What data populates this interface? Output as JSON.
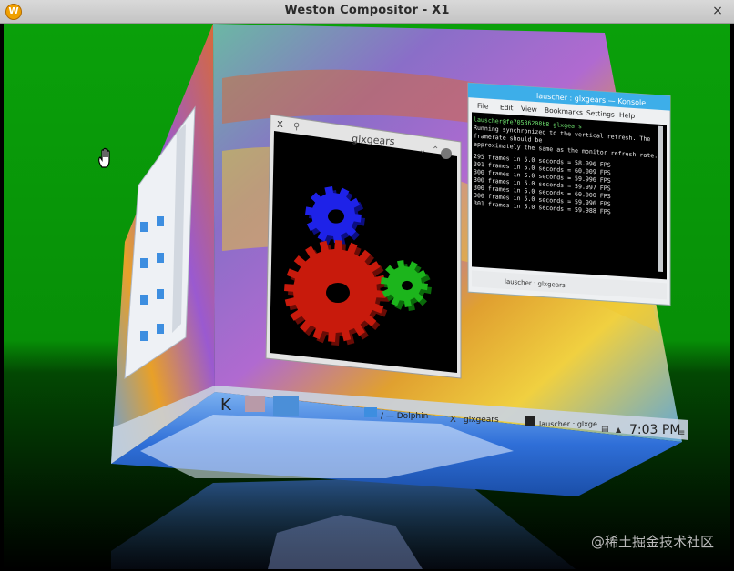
{
  "window": {
    "title": "Weston Compositor - X1",
    "close_glyph": "×",
    "app_icon_letter": "W"
  },
  "glxgears": {
    "title": "glxgears",
    "x_glyph": "X",
    "colors": {
      "blue": "#1e22e8",
      "red": "#c81a0c",
      "green": "#1cb51c"
    }
  },
  "konsole": {
    "title": "lauscher : glxgears — Konsole",
    "menu": [
      "File",
      "Edit",
      "View",
      "Bookmarks",
      "Settings",
      "Help"
    ],
    "lines": [
      "lauscher@fe70536208b8 glxgears",
      "Running synchronized to the vertical refresh.  The",
      "framerate should be",
      "approximately the same as the monitor refresh rate.",
      "295 frames in 5.0 seconds = 58.996 FPS",
      "301 frames in 5.0 seconds = 60.009 FPS",
      "300 frames in 5.0 seconds = 59.996 FPS",
      "300 frames in 5.0 seconds = 59.997 FPS",
      "300 frames in 5.0 seconds = 60.000 FPS",
      "300 frames in 5.0 seconds = 59.996 FPS",
      "301 frames in 5.0 seconds = 59.988 FPS"
    ],
    "tab": "lauscher : glxgears"
  },
  "taskbar": {
    "dolphin": "/ — Dolphin",
    "glxgears": "glxgears",
    "konsole": "lauscher : glxge…",
    "clock": "7:03 PM"
  },
  "watermark": "@稀土掘金技术社区",
  "colors": {
    "background": "#0a9a0a",
    "titlebar": "#d0d0d0"
  }
}
